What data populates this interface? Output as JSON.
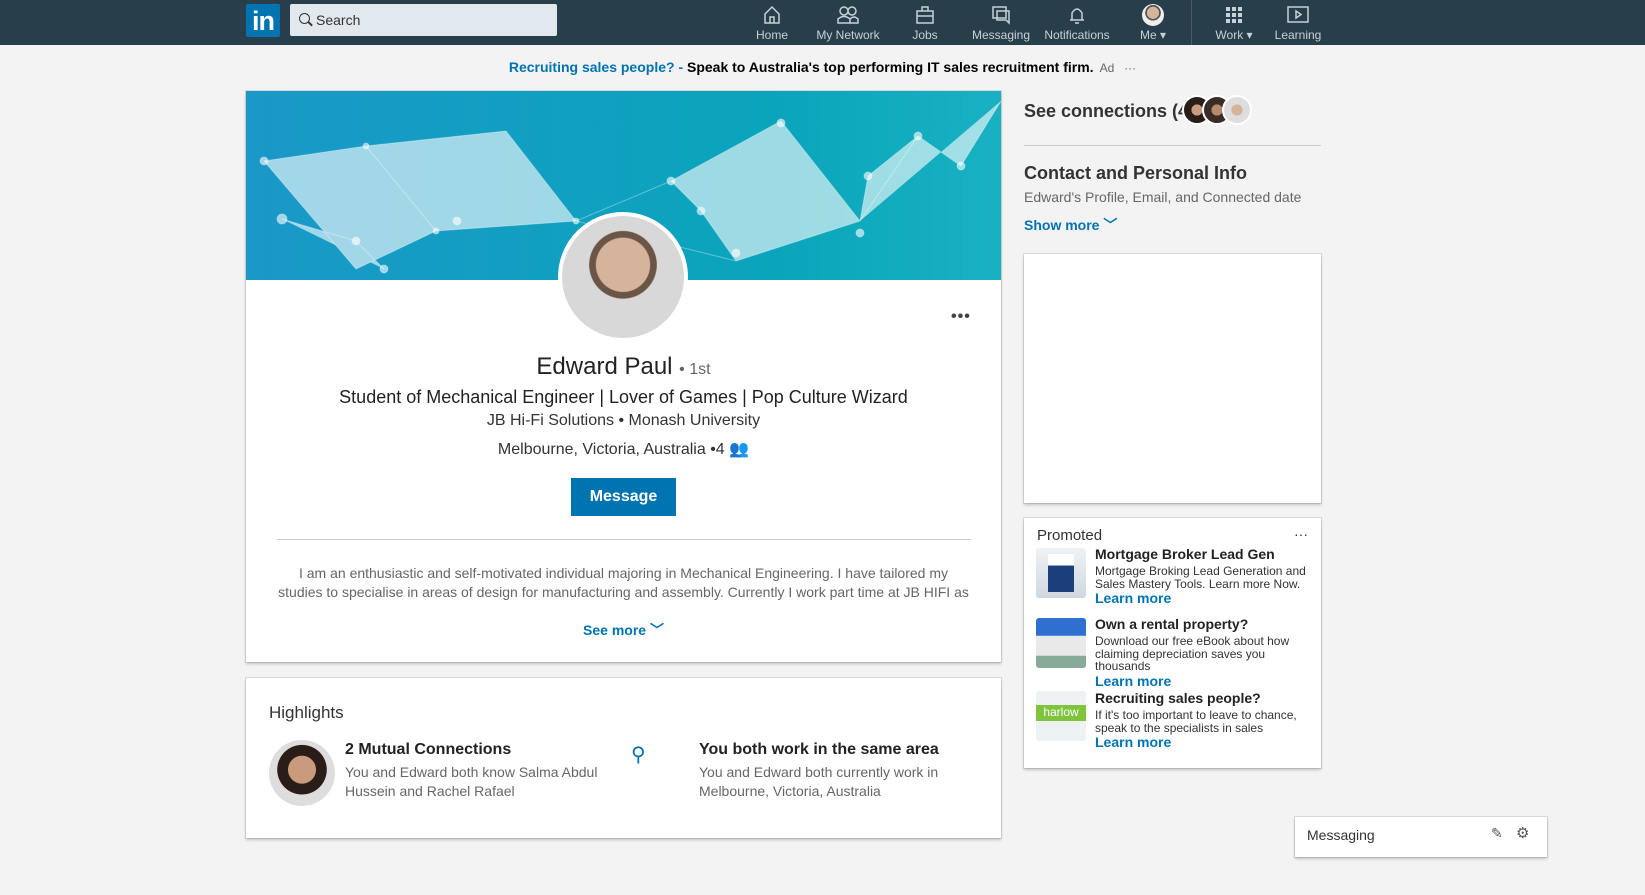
{
  "nav": {
    "logo": "in",
    "search_placeholder": "Search",
    "items": [
      {
        "label": "Home"
      },
      {
        "label": "My Network"
      },
      {
        "label": "Jobs"
      },
      {
        "label": "Messaging"
      },
      {
        "label": "Notifications"
      },
      {
        "label": "Me ▾"
      },
      {
        "label": "Work ▾"
      },
      {
        "label": "Learning"
      }
    ]
  },
  "ad": {
    "link": "Recruiting sales people? -",
    "text": "Speak to Australia's top performing IT sales recruitment firm.",
    "tag": "Ad",
    "more": "···"
  },
  "profile": {
    "name": "Edward Paul",
    "degree": "• 1st",
    "headline": "Student of Mechanical Engineer | Lover of Games | Pop Culture Wizard",
    "company": "JB Hi-Fi Solutions",
    "school": "Monash University",
    "location": "Melbourne, Victoria, Australia",
    "connections": "•4",
    "message_label": "Message",
    "more": "•••",
    "about": "I am an enthusiastic and self-motivated individual majoring in Mechanical Engineering. I have tailored my studies to specialise in areas of design for manufacturing and assembly. Currently I work part time at JB HIFI as a Technology…",
    "see_more": "See more"
  },
  "highlights": {
    "title": "Highlights",
    "items": [
      {
        "title": "2 Mutual Connections",
        "text": "You and Edward both know Salma Abdul Hussein and Rachel Rafael"
      },
      {
        "title": "You both work in the same area",
        "text": "You and Edward both currently work in Melbourne, Victoria, Australia"
      }
    ]
  },
  "sidebar": {
    "see_connections": "See connections (4)",
    "contact_title": "Contact and Personal Info",
    "contact_sub": "Edward's Profile, Email, and Connected date",
    "show_more": "Show more"
  },
  "promoted": {
    "title": "Promoted",
    "more": "···",
    "items": [
      {
        "title": "Mortgage Broker Lead Gen",
        "text": "Mortgage Broking Lead Generation and Sales Mastery Tools. Learn more Now.",
        "link": "Learn more"
      },
      {
        "title": "Own a rental property?",
        "text": "Download our free eBook about how claiming depreciation saves you thousands",
        "link": "Learn more"
      },
      {
        "title": "Recruiting sales people?",
        "text": "If it's too important to leave to chance, speak to the specialists in sales",
        "link": "Learn more",
        "logo": "harlow"
      }
    ]
  },
  "messaging": {
    "label": "Messaging"
  }
}
